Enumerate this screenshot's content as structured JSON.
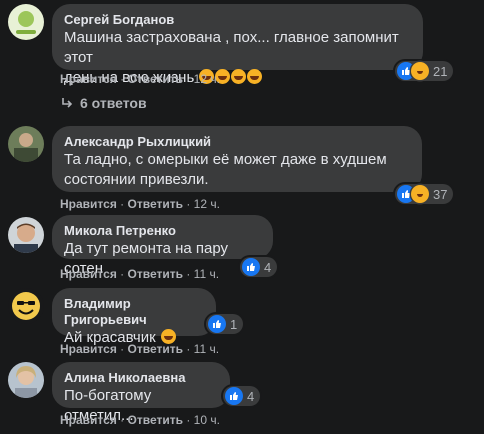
{
  "comments": [
    {
      "author": "Сергей Богданов",
      "text": "Машина застрахована , пох... главное запомнит этот\nдень на всю жизнь",
      "like": "Нравится",
      "reply": "Ответить",
      "time": "12 ч.",
      "reactions_count": "21",
      "reactions": [
        "like-icon",
        "haha-icon"
      ]
    },
    {
      "author": "Александр Рыхлицкий",
      "text": "Та ладно, с омерыки её может даже в худшем\nсостоянии привезли.",
      "like": "Нравится",
      "reply": "Ответить",
      "time": "12 ч.",
      "reactions_count": "37",
      "reactions": [
        "like-icon",
        "haha-icon"
      ]
    },
    {
      "author": "Микола Петренко",
      "text": "Да тут ремонта на пару сотен",
      "like": "Нравится",
      "reply": "Ответить",
      "time": "11 ч.",
      "reactions_count": "4",
      "reactions": [
        "like-icon"
      ]
    },
    {
      "author": "Владимир Григорьевич",
      "text": "Ай красавчик",
      "like": "Нравится",
      "reply": "Ответить",
      "time": "11 ч.",
      "reactions_count": "1",
      "reactions": [
        "like-icon"
      ]
    },
    {
      "author": "Алина Николаевна",
      "text": "По-богатому отметил...",
      "like": "Нравится",
      "reply": "Ответить",
      "time": "10 ч.",
      "reactions_count": "4",
      "reactions": [
        "like-icon"
      ]
    }
  ],
  "replies_link": "6 ответов",
  "separator": "·",
  "colors": {
    "background": "#18191a",
    "bubble": "#3a3b3c",
    "like_blue": "#1877f2",
    "haha_yellow": "#f7b125"
  }
}
